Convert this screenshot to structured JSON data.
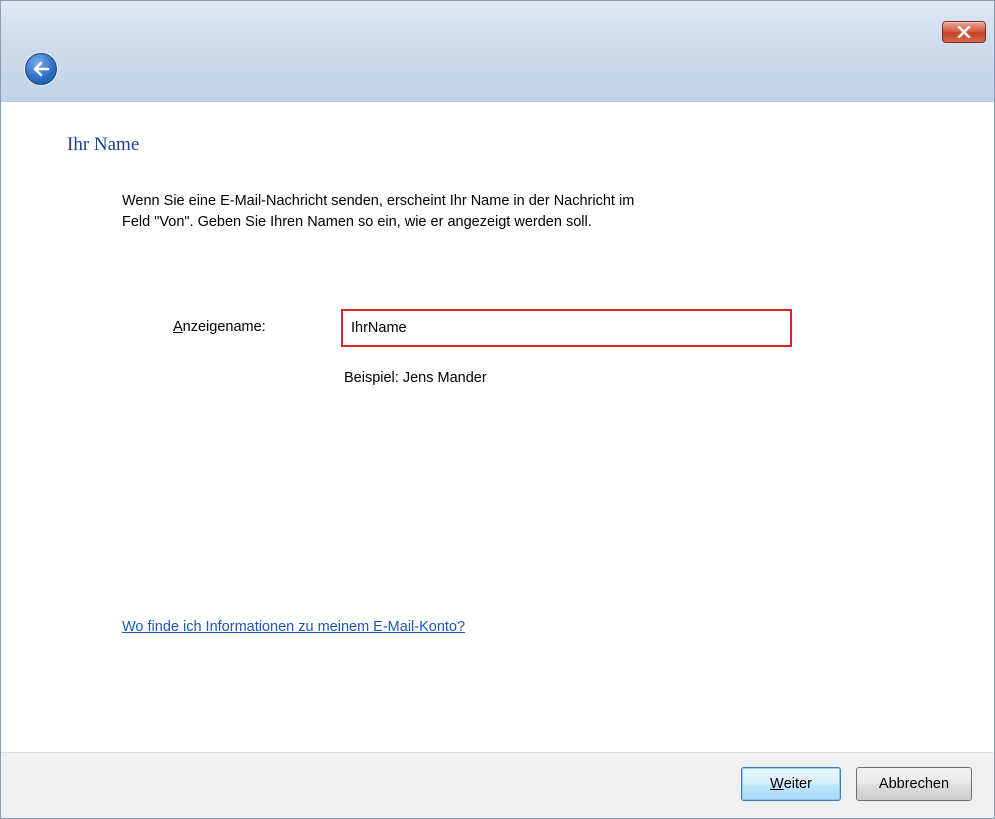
{
  "titlebar": {
    "close_icon": "close-x-icon",
    "back_icon": "back-arrow-icon"
  },
  "page": {
    "heading": "Ihr Name",
    "description_line1": "Wenn Sie eine E-Mail-Nachricht senden, erscheint Ihr Name in der Nachricht im",
    "description_line2": "Feld \"Von\". Geben Sie Ihren Namen so ein, wie er angezeigt werden soll."
  },
  "form": {
    "label_accel": "A",
    "label_rest": "nzeigename:",
    "value": "IhrName",
    "hint": "Beispiel: Jens Mander"
  },
  "help_link": "Wo finde ich Informationen zu meinem E-Mail-Konto?",
  "buttons": {
    "next_accel": "W",
    "next_rest": "eiter",
    "cancel": "Abbrechen"
  },
  "colors": {
    "heading": "#1e3f8a",
    "link": "#1c56b8",
    "highlight_border": "#d8232a"
  }
}
